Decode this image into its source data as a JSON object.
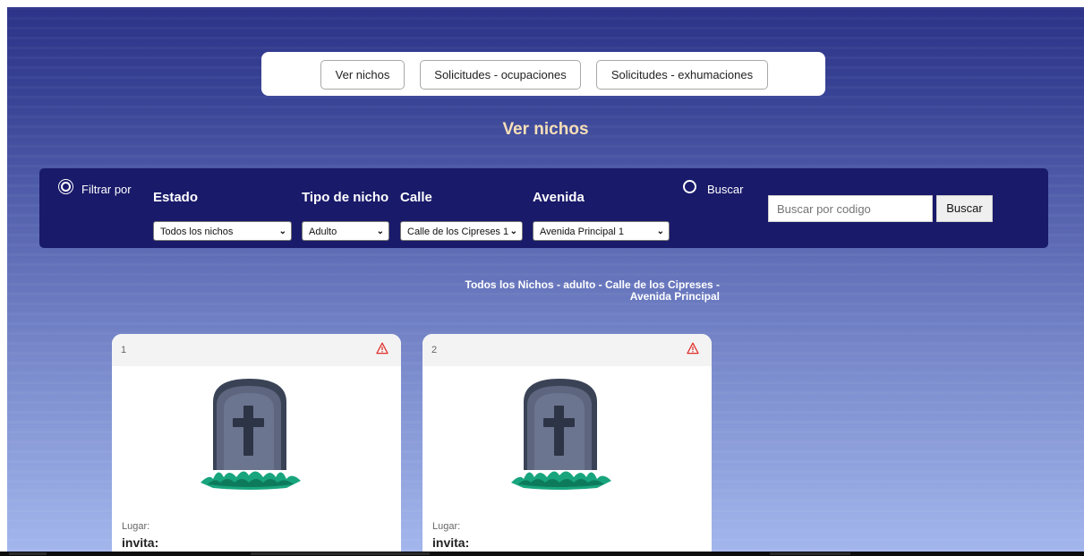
{
  "nav": {
    "buttons": [
      "Ver nichos",
      "Solicitudes - ocupaciones",
      "Solicitudes - exhumaciones"
    ]
  },
  "page_title": "Ver nichos",
  "filters": {
    "filter_label": "Filtrar por",
    "search_label": "Buscar",
    "columns": [
      {
        "heading": "Estado",
        "selected": "Todos los nichos"
      },
      {
        "heading": "Tipo de nicho",
        "selected": "Adulto"
      },
      {
        "heading": "Calle",
        "selected": "Calle de los Cipreses 1"
      },
      {
        "heading": "Avenida",
        "selected": "Avenida Principal 1"
      }
    ],
    "search_placeholder": "Buscar por codigo",
    "search_button": "Buscar",
    "filter_selected": true
  },
  "results": {
    "title_line1": "Todos los Nichos - adulto - Calle de los Cipreses -",
    "title_line2": "Avenida Principal"
  },
  "cards": [
    {
      "number": "1",
      "place_label": "Lugar:",
      "invite_label": "invita:"
    },
    {
      "number": "2",
      "place_label": "Lugar:",
      "invite_label": "invita:"
    }
  ],
  "colors": {
    "panel": "#191a6a",
    "title": "#f7dfb7",
    "warning": "#e0312c"
  },
  "icons": [
    "warning-icon",
    "tombstone-icon",
    "chevron-down-icon"
  ]
}
